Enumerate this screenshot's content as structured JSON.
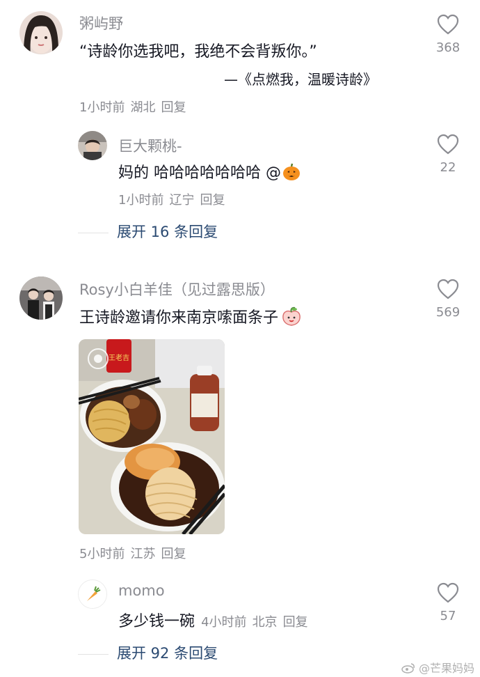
{
  "comments": [
    {
      "user": "粥屿野",
      "text": "“诗龄你选我吧，我绝不会背叛你。”",
      "quote_source": "—《点燃我，温暖诗龄》",
      "time": "1小时前",
      "location": "湖北",
      "reply_label": "回复",
      "likes": "368",
      "replies": [
        {
          "user": "巨大颗桃-",
          "text": "妈的  哈哈哈哈哈哈哈 @",
          "time": "1小时前",
          "location": "辽宁",
          "reply_label": "回复",
          "likes": "22"
        }
      ],
      "expand_label": "展开 16 条回复"
    },
    {
      "user": "Rosy小白羊佳（见过露思版）",
      "text": "王诗龄邀请你来南京嗦面条子",
      "time": "5小时前",
      "location": "江苏",
      "reply_label": "回复",
      "likes": "569",
      "photo_can_label": "王老吉",
      "replies": [
        {
          "user": "momo",
          "text": "多少钱一碗",
          "time": "4小时前",
          "location": "北京",
          "reply_label": "回复",
          "likes": "57"
        }
      ],
      "expand_label": "展开 92 条回复"
    }
  ],
  "watermark": "@芒果妈妈",
  "icons": {
    "like": "heart-outline-icon",
    "emoji1": "pumpkin-emoji-icon",
    "emoji2": "peach-emoji-icon",
    "avatar_momo": "carrot-icon"
  },
  "colors": {
    "name": "#8a8b91",
    "text": "#161823",
    "expand": "#2b4a72"
  }
}
